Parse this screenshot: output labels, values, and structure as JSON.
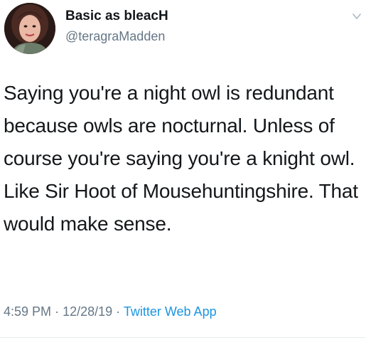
{
  "author": {
    "display_name": "Basic as bleacH",
    "handle": "@teragraMadden",
    "avatar_icon": "profile-photo"
  },
  "tweet": {
    "text": "Saying you're a night owl is redundant because owls are nocturnal. Unless of course you're saying you're a knight owl. Like Sir Hoot of Mousehuntingshire. That would make sense.",
    "time": "4:59 PM",
    "separator": "·",
    "date": "12/28/19",
    "source": "Twitter Web App"
  },
  "colors": {
    "text": "#14171a",
    "secondary": "#657786",
    "link": "#1b95e0",
    "divider": "#e6ecf0"
  },
  "icons": {
    "menu": "chevron-down-icon"
  }
}
